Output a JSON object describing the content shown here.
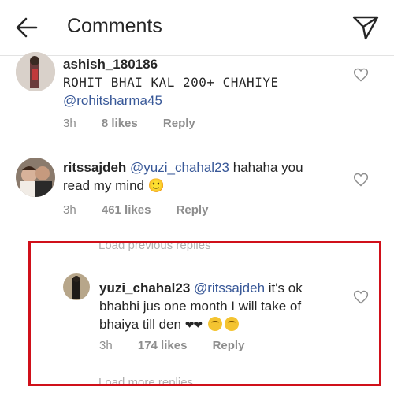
{
  "header": {
    "title": "Comments"
  },
  "comments": [
    {
      "username": "ashish_180186",
      "text": "ROHIT BHAI KAL 200+ CHAHIYE",
      "mention": "@rohitsharma45",
      "time": "3h",
      "likes": "8 likes",
      "reply": "Reply"
    },
    {
      "username": "ritssajdeh",
      "mention": "@yuzi_chahal23",
      "text": "hahaha you read my mind 🙂",
      "time": "3h",
      "likes": "461 likes",
      "reply": "Reply"
    }
  ],
  "thread": {
    "load_previous": "Load previous replies",
    "reply": {
      "username": "yuzi_chahal23",
      "mention": "@ritssajdeh",
      "text": "it's ok bhabhi  jus one month I will take of bhaiya till den",
      "hearts": "❤❤",
      "time": "3h",
      "likes": "174 likes",
      "reply": "Reply"
    },
    "load_more": "Load more replies"
  },
  "colors": {
    "mention": "#385898",
    "highlight_border": "#d0101a",
    "meta": "#8e8e8e"
  },
  "icons": {
    "back": "arrow-left-icon",
    "send": "paper-plane-icon",
    "like": "heart-outline-icon"
  }
}
